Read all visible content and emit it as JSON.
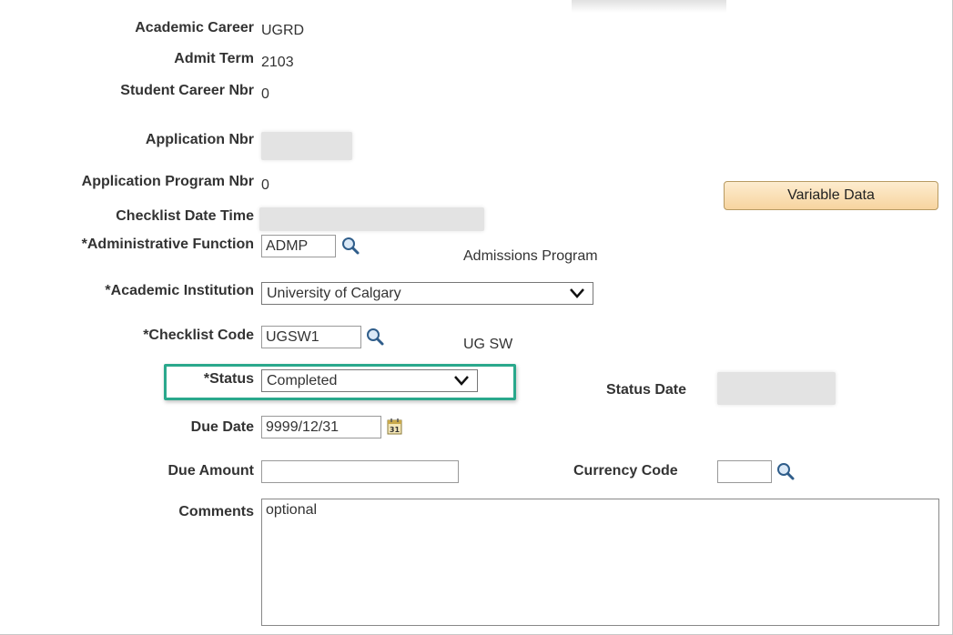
{
  "fields": {
    "academic_career": {
      "label": "Academic Career",
      "value": "UGRD"
    },
    "admit_term": {
      "label": "Admit Term",
      "value": "2103"
    },
    "student_career_nbr": {
      "label": "Student Career Nbr",
      "value": "0"
    },
    "application_nbr": {
      "label": "Application Nbr",
      "value": ""
    },
    "application_program_nbr": {
      "label": "Application Program Nbr",
      "value": "0"
    },
    "checklist_date_time": {
      "label": "Checklist Date Time",
      "value": ""
    },
    "administrative_function": {
      "label": "*Administrative Function",
      "value": "ADMP",
      "description": "Admissions Program"
    },
    "academic_institution": {
      "label": "*Academic Institution",
      "value": "University of Calgary"
    },
    "checklist_code": {
      "label": "*Checklist Code",
      "value": "UGSW1",
      "description": "UG SW"
    },
    "status": {
      "label": "*Status",
      "value": "Completed"
    },
    "status_date": {
      "label": "Status Date",
      "value": ""
    },
    "due_date": {
      "label": "Due Date",
      "value": "9999/12/31"
    },
    "due_amount": {
      "label": "Due Amount",
      "value": ""
    },
    "currency_code": {
      "label": "Currency Code",
      "value": ""
    },
    "comments": {
      "label": "Comments",
      "value": "optional"
    }
  },
  "buttons": {
    "variable_data": "Variable Data"
  },
  "calendar_icon_text": "31",
  "colors": {
    "highlight": "#2aa88c",
    "button_top": "#fdeccf",
    "button_bottom": "#f7d49f"
  },
  "icons": {
    "lookup": "magnifier-icon",
    "calendar": "calendar-icon",
    "dropdown": "chevron-down-icon"
  }
}
